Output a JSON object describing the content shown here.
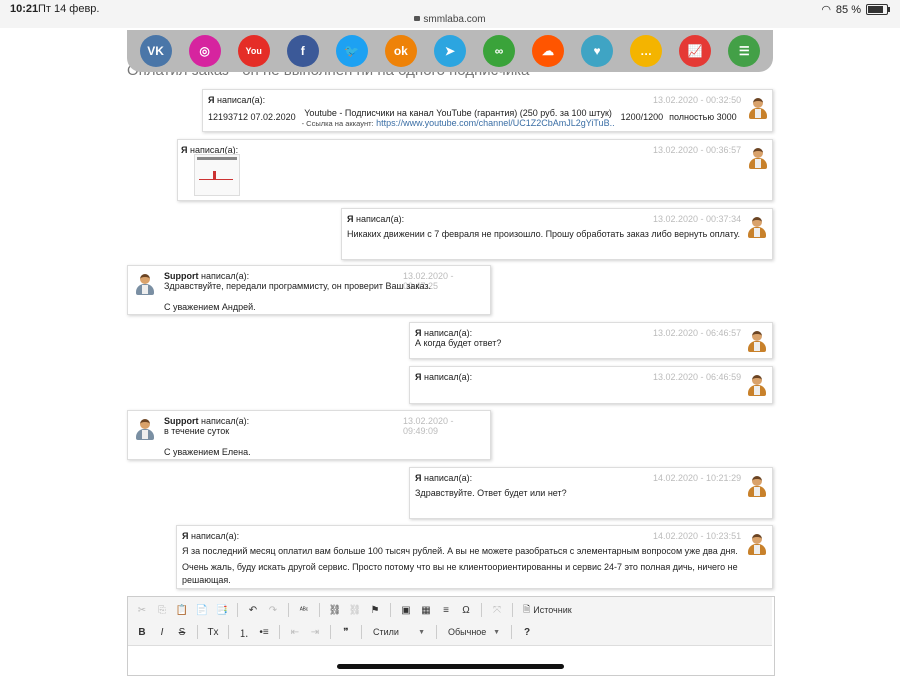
{
  "status_bar": {
    "time": "10:21",
    "date": "Пт 14 февр.",
    "url": "smmlaba.com",
    "battery": "85 %",
    "battery_level": 0.85
  },
  "social_icons": [
    {
      "name": "vk-icon",
      "glyph": "VK",
      "color": "#4a76a8"
    },
    {
      "name": "instagram-icon",
      "glyph": "◎",
      "color": "#d6249f"
    },
    {
      "name": "youtube-icon",
      "glyph": "You",
      "color": "#e52d27"
    },
    {
      "name": "facebook-icon",
      "glyph": "f",
      "color": "#3b5998"
    },
    {
      "name": "twitter-icon",
      "glyph": "🐦",
      "color": "#1da1f2"
    },
    {
      "name": "odnoklassniki-icon",
      "glyph": "ok",
      "color": "#ee8208"
    },
    {
      "name": "telegram-icon",
      "glyph": "➤",
      "color": "#2ca5e0"
    },
    {
      "name": "likee-icon",
      "glyph": "∞",
      "color": "#3aa33a"
    },
    {
      "name": "soundcloud-icon",
      "glyph": "☁",
      "color": "#ff5500"
    },
    {
      "name": "periscope-icon",
      "glyph": "♥",
      "color": "#3fa4c4"
    },
    {
      "name": "chat-icon",
      "glyph": "…",
      "color": "#f4b400"
    },
    {
      "name": "stats-icon",
      "glyph": "📈",
      "color": "#e53935"
    },
    {
      "name": "document-icon",
      "glyph": "☰",
      "color": "#43a047"
    }
  ],
  "page_title": "Оплатил заказ - он не выполнен ни на одного подписчика",
  "order": {
    "id_date": "12193712 07.02.2020",
    "service": "Youtube - Подписчики на канал YouTube (гарантия) (250 руб. за 100 штук)",
    "link_label": "- Ссылка на аккаунт:",
    "link": "https://www.youtube.com/channel/UC1Z2CbAmJL2gYiTuB..",
    "progress": "1200/1200",
    "status": "полностью 3000"
  },
  "messages": [
    {
      "author": "Я",
      "suffix": " написал(а):",
      "time": "13.02.2020 - 00:32:50",
      "lines": []
    },
    {
      "author": "Я",
      "suffix": " написал(а):",
      "time": "13.02.2020 - 00:36:57",
      "lines": []
    },
    {
      "author": "Я",
      "suffix": " написал(а):",
      "time": "13.02.2020 - 00:37:34",
      "lines": [
        "Никаких движении с 7 февраля не произошло. Прошу обработать заказ либо вернуть оплату."
      ]
    },
    {
      "author": "Support",
      "suffix": " написал(а):",
      "time": "13.02.2020 - 00:47:25",
      "lines": [
        "Здравствуйте, передали программисту, он проверит Ваш заказ.",
        "С уважением Андрей."
      ]
    },
    {
      "author": "Я",
      "suffix": " написал(а):",
      "time": "13.02.2020 - 06:46:57",
      "lines": [
        "А когда будет ответ?"
      ]
    },
    {
      "author": "Я",
      "suffix": " написал(а):",
      "time": "13.02.2020 - 06:46:59",
      "lines": []
    },
    {
      "author": "Support",
      "suffix": " написал(а):",
      "time": "13.02.2020 - 09:49:09",
      "lines": [
        "в течение суток",
        "С уважением Елена."
      ]
    },
    {
      "author": "Я",
      "suffix": " написал(а):",
      "time": "14.02.2020 - 10:21:29",
      "lines": [
        "Здравствуйте. Ответ будет или нет?"
      ]
    },
    {
      "author": "Я",
      "suffix": " написал(а):",
      "time": "14.02.2020 - 10:23:51",
      "lines": [
        "Я за последний месяц оплатил вам больше 100 тысяч рублей. А вы не можете разобраться с элементарным вопросом уже два дня.",
        "Очень жаль, буду искать другой сервис. Просто потому что вы не клиентоориентированны и сервис 24-7 это полная дичь, ничего не",
        "решающая."
      ]
    }
  ],
  "editor": {
    "source_label": "Источник",
    "styles_label": "Стили",
    "format_label": "Обычное",
    "tools_row1": [
      {
        "name": "cut-icon",
        "g": "✂",
        "dim": true
      },
      {
        "name": "copy-icon",
        "g": "⎘",
        "dim": true
      },
      {
        "name": "paste-icon",
        "g": "📋",
        "dim": false
      },
      {
        "name": "paste-text-icon",
        "g": "📄",
        "dim": false
      },
      {
        "name": "paste-word-icon",
        "g": "📑",
        "dim": false
      },
      {
        "sep": true
      },
      {
        "name": "undo-icon",
        "g": "↶",
        "dim": false
      },
      {
        "name": "redo-icon",
        "g": "↷",
        "dim": true
      },
      {
        "sep": true
      },
      {
        "name": "spellcheck-icon",
        "g": "ᴬᴮᶜ",
        "dim": false
      },
      {
        "sep": true
      },
      {
        "name": "link-icon",
        "g": "⛓",
        "dim": false
      },
      {
        "name": "unlink-icon",
        "g": "⛓",
        "dim": true
      },
      {
        "name": "anchor-flag-icon",
        "g": "⚑",
        "dim": false
      },
      {
        "sep": true
      },
      {
        "name": "image-icon",
        "g": "▣",
        "dim": false
      },
      {
        "name": "table-icon",
        "g": "▦",
        "dim": false
      },
      {
        "name": "horizontal-line-icon",
        "g": "≡",
        "dim": false
      },
      {
        "name": "special-char-icon",
        "g": "Ω",
        "dim": false
      },
      {
        "sep": true
      },
      {
        "name": "maximize-icon",
        "g": "⤧",
        "dim": true
      },
      {
        "sep": true
      }
    ],
    "tools_row2": [
      {
        "name": "bold-icon",
        "g": "B",
        "dim": false
      },
      {
        "name": "italic-icon",
        "g": "I",
        "dim": false
      },
      {
        "name": "strikethrough-icon",
        "g": "S",
        "dim": false
      },
      {
        "sep": true
      },
      {
        "name": "remove-format-icon",
        "g": "Tx",
        "dim": false
      },
      {
        "sep": true
      },
      {
        "name": "numbered-list-icon",
        "g": "⒈",
        "dim": false
      },
      {
        "name": "bulleted-list-icon",
        "g": "•≡",
        "dim": false
      },
      {
        "sep": true
      },
      {
        "name": "outdent-icon",
        "g": "⇤",
        "dim": true
      },
      {
        "name": "indent-icon",
        "g": "⇥",
        "dim": true
      },
      {
        "sep": true
      },
      {
        "name": "blockquote-icon",
        "g": "❞",
        "dim": false
      },
      {
        "sep": true
      }
    ]
  }
}
